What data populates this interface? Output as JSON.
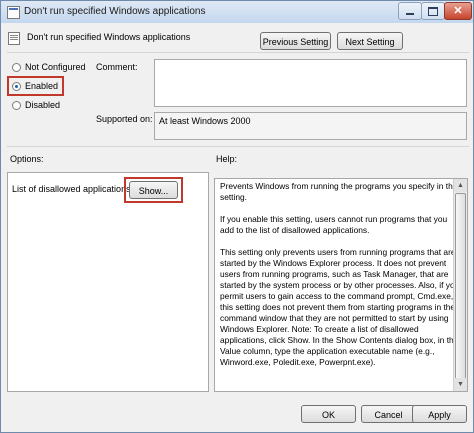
{
  "window": {
    "title": "Don't run specified Windows applications",
    "close_glyph": "✕"
  },
  "header": {
    "policy_title": "Don't run specified Windows applications",
    "previous_setting": "Previous Setting",
    "next_setting": "Next Setting"
  },
  "state": {
    "not_configured": "Not Configured",
    "enabled": "Enabled",
    "disabled": "Disabled",
    "selected": "Enabled"
  },
  "fields": {
    "comment_label": "Comment:",
    "comment_value": "",
    "supported_on_label": "Supported on:",
    "supported_on_value": "At least Windows 2000"
  },
  "options": {
    "label": "Options:",
    "disallowed_label": "List of disallowed applications",
    "show_button": "Show..."
  },
  "help": {
    "label": "Help:",
    "paragraphs": [
      "Prevents Windows from running the programs you specify in this setting.",
      "If you enable this setting, users cannot run programs that you add to the list of disallowed applications.",
      "This setting only prevents users from running programs that are started by the Windows Explorer process. It does not prevent users from running programs, such as Task Manager, that are started by the system process or by other processes. Also, if you permit users to gain access to the command prompt, Cmd.exe, this setting does not prevent them from starting programs in the command window that they are not permitted to start by using Windows Explorer. Note: To create a list of disallowed applications, click Show. In the Show Contents dialog box, in the Value column, type the application executable name (e.g., Winword.exe, Poledit.exe, Powerpnt.exe)."
    ]
  },
  "footer": {
    "ok": "OK",
    "cancel": "Cancel",
    "apply": "Apply"
  },
  "colors": {
    "highlight_box": "#c0392b",
    "dialog_bg": "#f0f0f0",
    "titlebar": "#c4d7ee"
  },
  "icons": [
    "policy-icon",
    "close-icon",
    "minimize-icon",
    "maximize-icon"
  ]
}
